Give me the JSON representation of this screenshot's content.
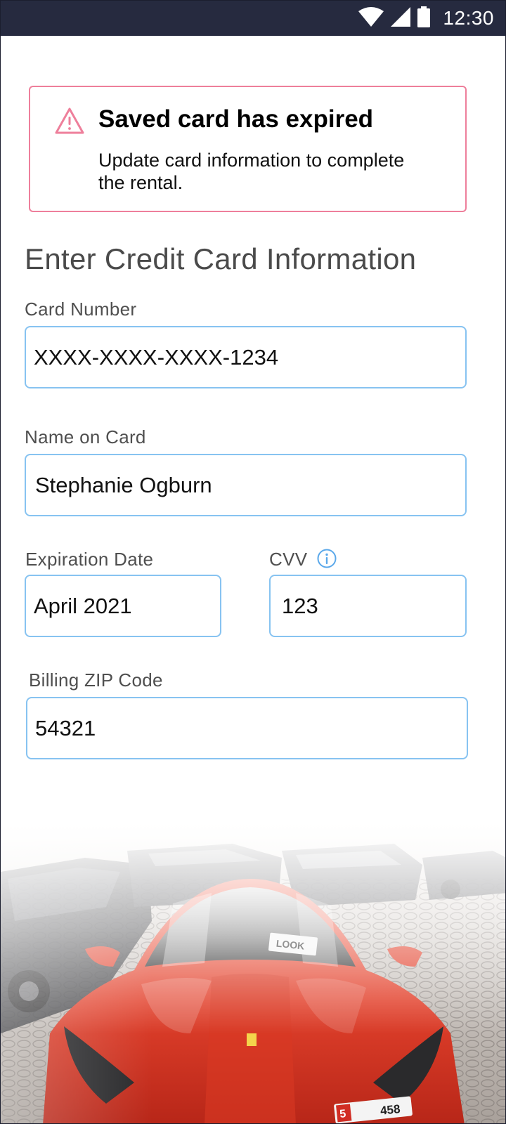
{
  "status_bar": {
    "time": "12:30",
    "icons": [
      "wifi-icon",
      "cell-signal-icon",
      "battery-icon"
    ]
  },
  "alert": {
    "icon": "warning-triangle-icon",
    "title": "Saved card has expired",
    "message_line1": "Update card information to complete",
    "message_line2": "the rental.",
    "border_color": "#ee7f9b"
  },
  "form": {
    "heading": "Enter Credit Card Information",
    "card_number": {
      "label": "Card Number",
      "value": "XXXX-XXXX-XXXX-1234"
    },
    "name_on_card": {
      "label": "Name on Card",
      "value": "Stephanie Ogburn"
    },
    "expiration_date": {
      "label": "Expiration Date",
      "value": "April 2021"
    },
    "cvv": {
      "label": "CVV",
      "value": "123",
      "info_icon": "info-icon"
    },
    "billing_zip": {
      "label": "Billing ZIP Code",
      "value": "54321"
    },
    "field_border_color": "#87c3f1"
  },
  "hero_image": {
    "subject": "red sports car in parking lot",
    "plate_number": "458",
    "plate_prefix": "5",
    "windshield_sign": "LOOK"
  }
}
